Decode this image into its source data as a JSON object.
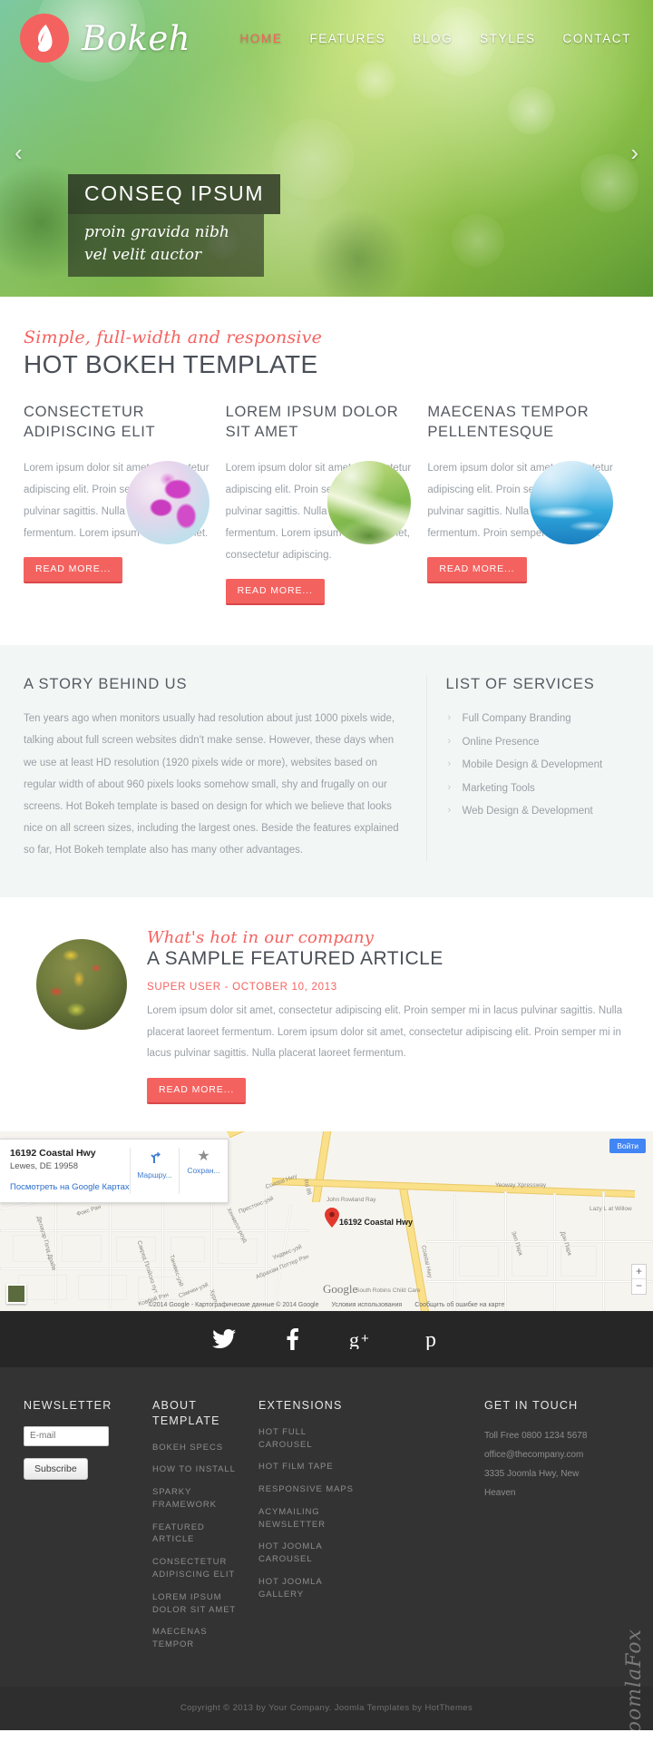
{
  "brand": {
    "name": "Bokeh",
    "logo_icon": "flame-leaf-icon",
    "accent_color": "#f4625f"
  },
  "nav": {
    "items": [
      {
        "label": "HOME",
        "active": true
      },
      {
        "label": "FEATURES",
        "active": false
      },
      {
        "label": "BLOG",
        "active": false
      },
      {
        "label": "STYLES",
        "active": false
      },
      {
        "label": "CONTACT",
        "active": false
      }
    ]
  },
  "hero": {
    "prev_arrow": "‹",
    "next_arrow": "›",
    "caption_title": "CONSEQ IPSUM",
    "caption_sub": "proin gravida nibh vel velit auctor"
  },
  "intro": {
    "eyebrow": "Simple, full-width and responsive",
    "title": "HOT BOKEH TEMPLATE"
  },
  "columns": [
    {
      "title": "CONSECTETUR ADIPISCING ELIT",
      "body": "Lorem ipsum dolor sit amet, consectetur adipiscing elit. Proin semper mi in lacus pulvinar sagittis. Nulla placerat laoreet fermentum. Lorem ipsum dolor sit amet.",
      "button": "READ MORE...",
      "image_name": "orchid-flower-image"
    },
    {
      "title": "LOREM IPSUM DOLOR SIT AMET",
      "body": "Lorem ipsum dolor sit amet, consectetur adipiscing elit. Proin semper mi in lacus pulvinar sagittis. Nulla placerat laoreet fermentum. Lorem ipsum dolor sit amet, consectetur adipiscing.",
      "button": "READ MORE...",
      "image_name": "green-path-landscape-image"
    },
    {
      "title": "MAECENAS TEMPOR PELLENTESQUE",
      "body": "Lorem ipsum dolor sit amet, consectetur adipiscing elit. Proin semper mi in lacus pulvinar sagittis. Nulla placerat laoreet fermentum. Proin semper mi in lacus.",
      "button": "READ MORE...",
      "image_name": "blue-sea-image"
    }
  ],
  "story": {
    "title": "A STORY BEHIND US",
    "body": "Ten years ago when monitors usually had resolution about just 1000 pixels wide, talking about full screen websites didn't make sense. However, these days when we use at least HD resolution (1920 pixels wide or more), websites based on regular width of about 960 pixels looks somehow small, shy and frugally on our screens. Hot Bokeh template is based on design for which we believe that looks nice on all screen sizes, including the largest ones. Beside the features explained so far, Hot Bokeh template also has many other advantages."
  },
  "services": {
    "title": "LIST OF SERVICES",
    "chevron": "›",
    "items": [
      "Full Company Branding",
      "Online Presence",
      "Mobile Design & Development",
      "Marketing Tools",
      "Web Design & Development"
    ]
  },
  "featured": {
    "eyebrow": "What's hot in our company",
    "title": "A SAMPLE FEATURED ARTICLE",
    "meta": "SUPER USER - OCTOBER 10, 2013",
    "body": "Lorem ipsum dolor sit amet, consectetur adipiscing elit. Proin semper mi in lacus pulvinar sagittis. Nulla placerat laoreet fermentum. Lorem ipsum dolor sit amet, consectetur adipiscing elit. Proin semper mi in lacus pulvinar sagittis. Nulla placerat laoreet fermentum.",
    "button": "READ MORE...",
    "image_name": "autumn-leaves-image"
  },
  "map": {
    "info_title": "16192 Coastal Hwy",
    "info_sub": "Lewes, DE 19958",
    "info_link": "Посмотреть на Google Картах",
    "action_directions": "Маршру...",
    "action_save": "Сохран...",
    "marker_label": "16192 Coastal Hwy",
    "login_button": "Войти",
    "logo": "Google",
    "zoom_in": "+",
    "zoom_out": "−",
    "attribution": [
      "©2014 Google - Картографические данные © 2014 Google",
      "Условия использования",
      "Сообщить об ошибке на карте"
    ],
    "street_labels": [
      "Coastal Hwy",
      "Coastal Hwy",
      "Rd 88",
      "Престонс-уэй",
      "Ундвес-уэй",
      "Абрахам Поттер Рэн",
      "Хенвелл-роуд",
      "Фокс Ран",
      "Делауэр Голд Драйв",
      "Сакред Плэйсиз пут",
      "Танквес-уэй",
      "John Rowland Ray",
      "Lazy L at Willow",
      "Зип Парк",
      "Дэн Парк",
      "Сэмчки-уэй",
      "Хурл",
      "Ковбой Рэн",
      "South Robins Child Care",
      "Yeoway Xpressway"
    ]
  },
  "social": {
    "items": [
      {
        "name": "twitter-icon",
        "glyph": "twitter"
      },
      {
        "name": "facebook-icon",
        "glyph": "facebook"
      },
      {
        "name": "googleplus-icon",
        "glyph": "googleplus"
      },
      {
        "name": "pinterest-icon",
        "glyph": "pinterest"
      }
    ]
  },
  "footer": {
    "newsletter": {
      "title": "NEWSLETTER",
      "placeholder": "E-mail",
      "value": "",
      "button": "Subscribe"
    },
    "about": {
      "title": "ABOUT TEMPLATE",
      "links": [
        "BOKEH SPECS",
        "HOW TO INSTALL",
        "SPARKY FRAMEWORK",
        "FEATURED ARTICLE",
        "CONSECTETUR ADIPISCING ELIT",
        "LOREM IPSUM DOLOR SIT AMET",
        "MAECENAS TEMPOR"
      ]
    },
    "extensions": {
      "title": "EXTENSIONS",
      "links": [
        "HOT FULL CAROUSEL",
        "HOT FILM TAPE",
        "RESPONSIVE MAPS",
        "ACYMAILING NEWSLETTER",
        "HOT JOOMLA CAROUSEL",
        "HOT JOOMLA GALLERY"
      ]
    },
    "contact": {
      "title": "GET IN TOUCH",
      "lines": [
        "Toll Free  0800 1234 5678",
        "office@thecompany.com",
        "3335 Joomla Hwy, New",
        "Heaven"
      ]
    },
    "watermark": "JoomlaFox",
    "copyright": "Copyright © 2013 by Your Company. Joomla Templates by HotThemes"
  }
}
